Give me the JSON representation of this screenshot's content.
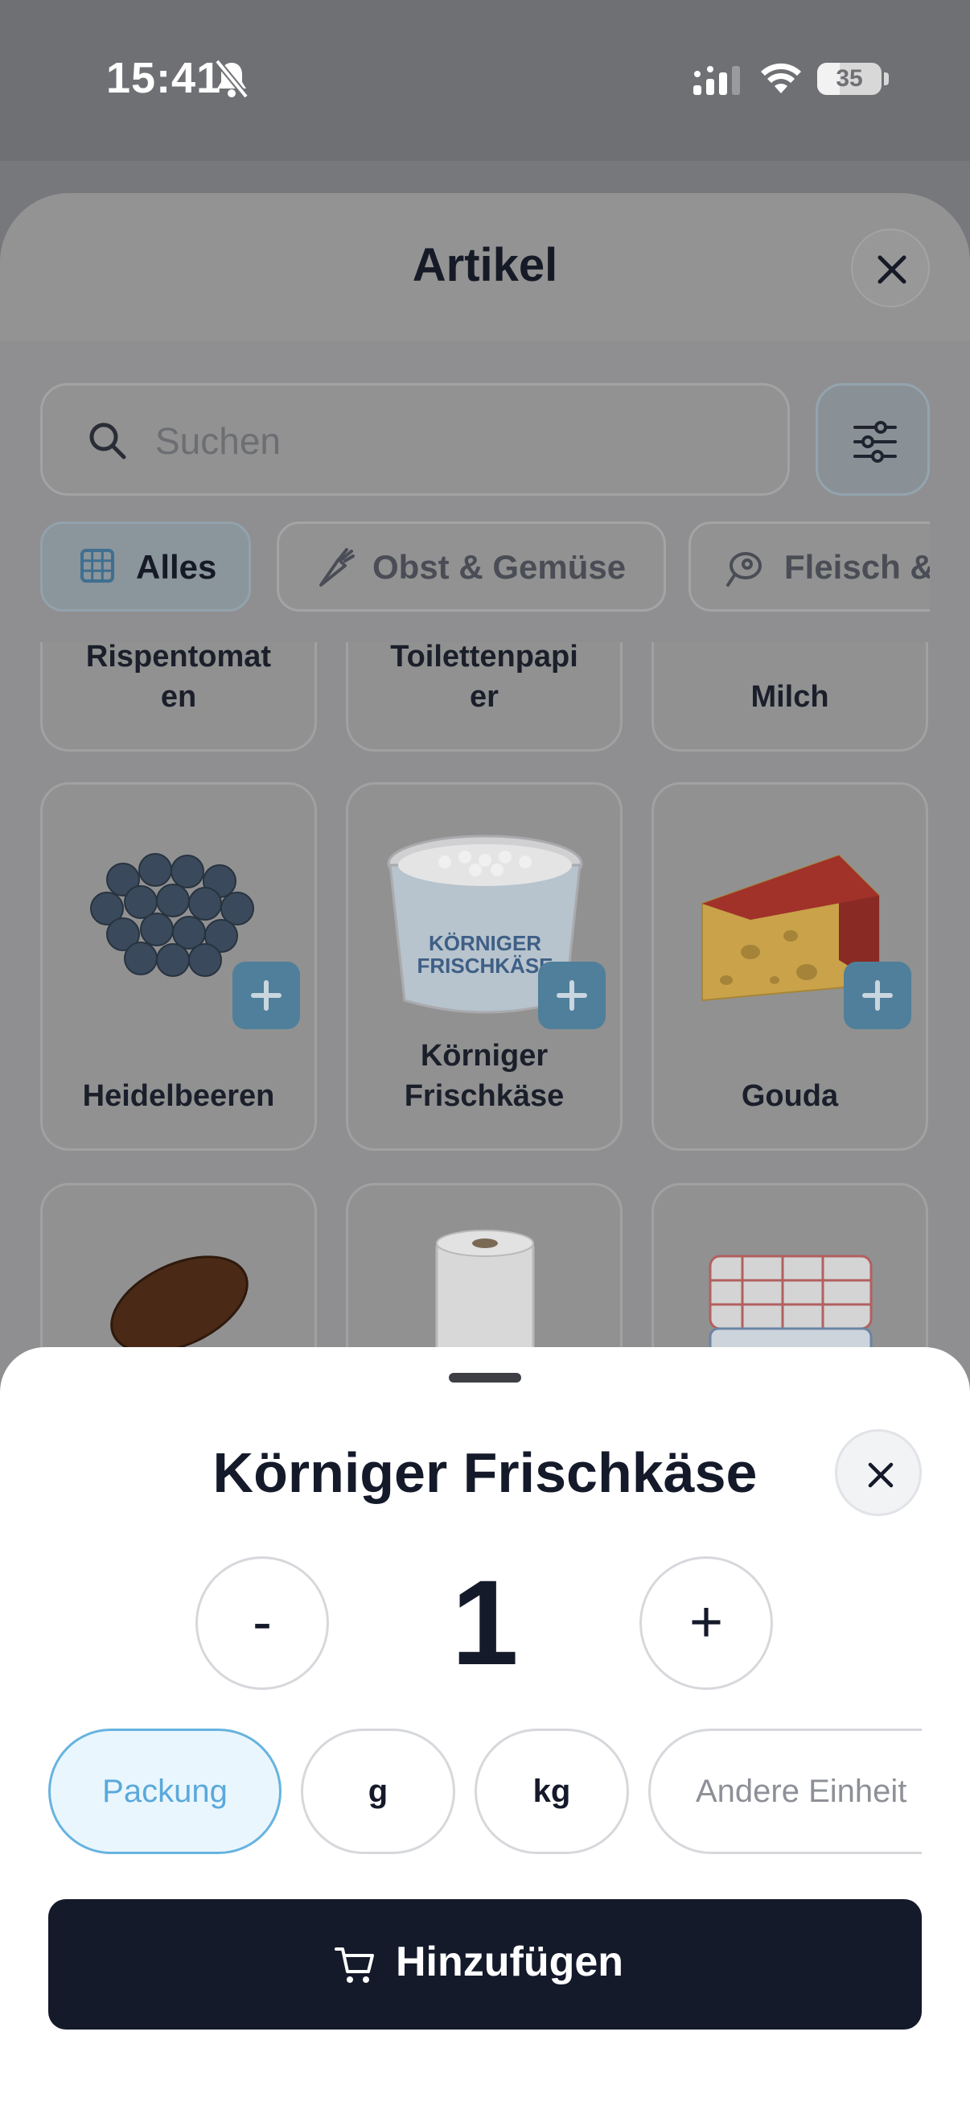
{
  "status_bar": {
    "time": "15:41",
    "battery_level": "35"
  },
  "sheet": {
    "title": "Artikel",
    "search": {
      "placeholder": "Suchen"
    },
    "categories": [
      {
        "label": "Alles",
        "icon": "grid-icon",
        "active": true
      },
      {
        "label": "Obst & Gemüse",
        "icon": "carrot-icon",
        "active": false
      },
      {
        "label": "Fleisch &",
        "icon": "meat-icon",
        "active": false
      }
    ],
    "items_top_row": [
      "Rispentomat\nen",
      "Toilettenpapi\ner",
      "Milch"
    ],
    "items_middle_row": [
      {
        "name": "Heidelbeeren",
        "image": "blueberries-image"
      },
      {
        "name": "Körniger\nFrischkäse",
        "image": "cottage-cheese-image"
      },
      {
        "name": "Gouda",
        "image": "gouda-cheese-image"
      }
    ],
    "items_bottom_row": [
      {
        "image": "dates-image"
      },
      {
        "image": "paper-towel-image"
      },
      {
        "image": "dish-towels-image"
      }
    ]
  },
  "modal": {
    "title": "Körniger Frischkäse",
    "quantity": "1",
    "minus_label": "-",
    "plus_label": "+",
    "units": [
      {
        "label": "Packung",
        "selected": true
      },
      {
        "label": "g",
        "selected": false
      },
      {
        "label": "kg",
        "selected": false
      },
      {
        "label": "Andere Einheit",
        "selected": false
      }
    ],
    "add_label": "Hinzufügen"
  },
  "colors": {
    "primary_dark": "#141a2a",
    "accent_blue": "#5aa9db",
    "accent_blue_bg": "#eaf6fd",
    "overlay": "#8f8f91"
  }
}
